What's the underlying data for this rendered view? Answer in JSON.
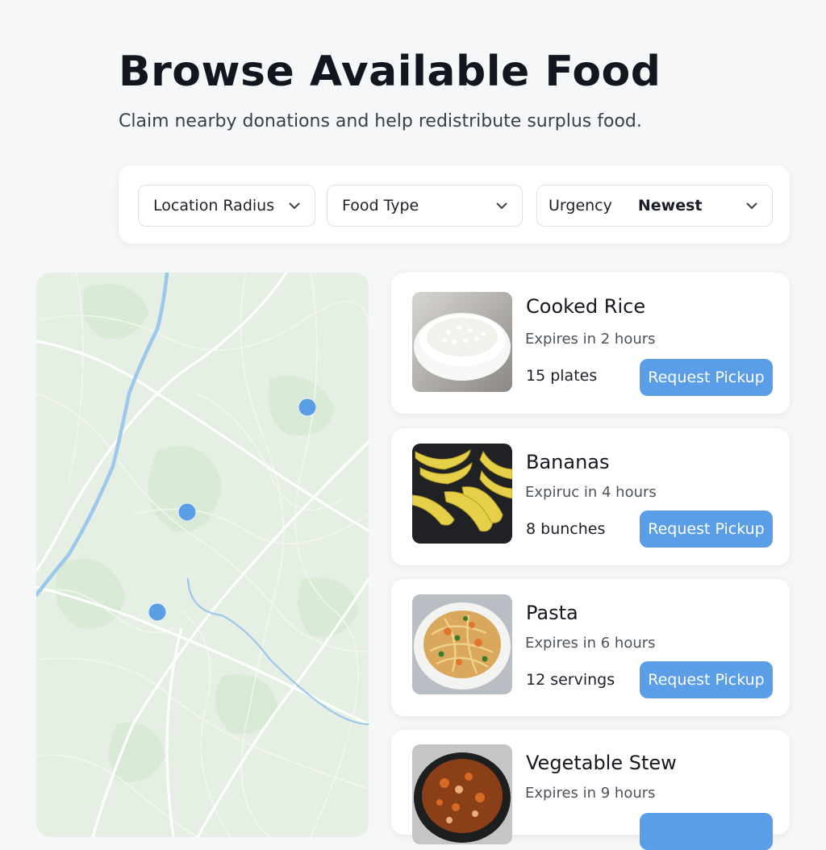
{
  "header": {
    "title": "Browse Available Food",
    "subtitle": "Claim nearby donations and help redistribute surplus food."
  },
  "filters": {
    "location": {
      "label": "Location Radius"
    },
    "food_type": {
      "label": "Food Type"
    },
    "urgency": {
      "label": "Urgency",
      "value": "Newest"
    }
  },
  "map": {
    "marker_color": "#5a9fe6",
    "marker_count": 3
  },
  "listings": [
    {
      "title": "Cooked Rice",
      "expiry": "Expires in 2 hours",
      "quantity": "15 plates",
      "button": "Request Pickup",
      "image": "rice-bowl-image"
    },
    {
      "title": "Bananas",
      "expiry": "Expiruc in 4 hours",
      "quantity": "8 bunches",
      "button": "Request Pickup",
      "image": "bananas-image"
    },
    {
      "title": "Pasta",
      "expiry": "Expires in 6 hours",
      "quantity": "12 servings",
      "button": "Request Pickup",
      "image": "pasta-bowl-image"
    },
    {
      "title": "Vegetable Stew",
      "expiry": "Expires in 9 hours",
      "quantity": "",
      "button": "",
      "image": "stew-bowl-image"
    }
  ],
  "colors": {
    "accent": "#5b9ee8",
    "background": "#f6f7f8",
    "map_land": "#e5efe3",
    "map_water": "#9cc8ee"
  }
}
